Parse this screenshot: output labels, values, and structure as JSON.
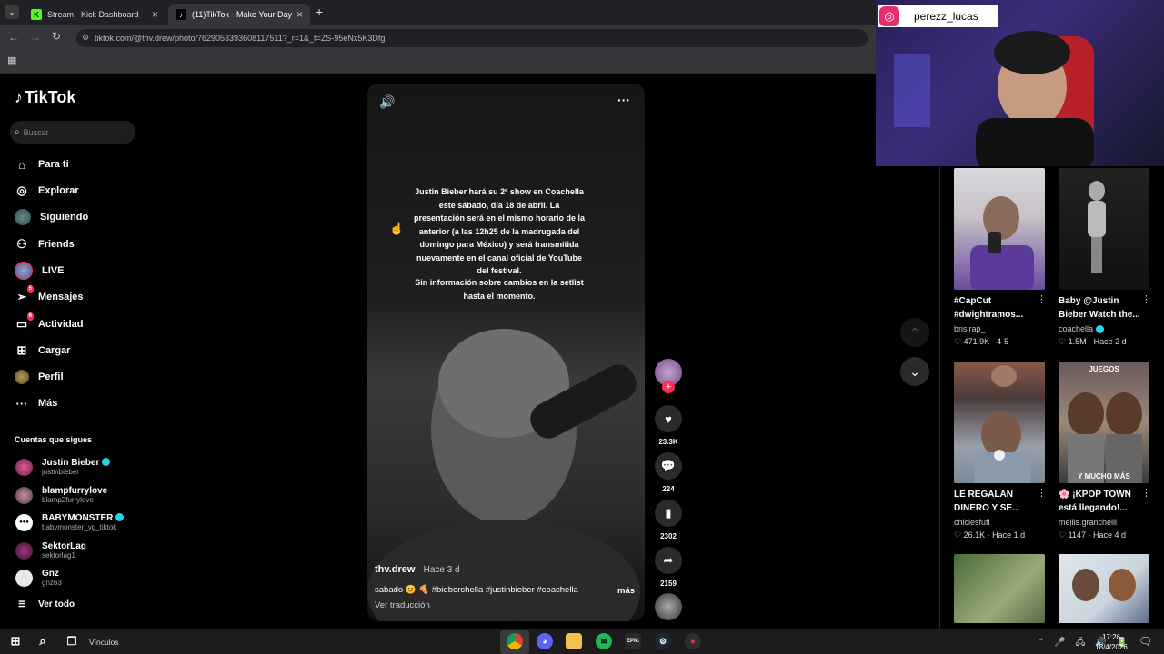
{
  "browser": {
    "tabs": [
      {
        "title": "Stream - Kick Dashboard",
        "active": false
      },
      {
        "title": "(11)TikTok - Make Your Day",
        "active": true
      }
    ],
    "new_tab": "+",
    "url": "tiktok.com/@thv.drew/photo/7629053393608117511?_r=1&_t=ZS-95eNx5K3Dfg"
  },
  "tiktok": {
    "logo": "TikTok",
    "search_placeholder": "Buscar",
    "nav": [
      {
        "label": "Para ti",
        "icon": "home-icon"
      },
      {
        "label": "Explorar",
        "icon": "compass-icon"
      },
      {
        "label": "Siguiendo",
        "icon": "following-avatar"
      },
      {
        "label": "Friends",
        "icon": "friends-icon"
      },
      {
        "label": "LIVE",
        "icon": "live-avatar"
      },
      {
        "label": "Mensajes",
        "icon": "send-icon",
        "badge": "5"
      },
      {
        "label": "Actividad",
        "icon": "activity-icon",
        "badge": "6"
      },
      {
        "label": "Cargar",
        "icon": "plus-icon"
      },
      {
        "label": "Perfil",
        "icon": "profile-avatar"
      },
      {
        "label": "Más",
        "icon": "more-icon"
      }
    ],
    "following_heading": "Cuentas que sigues",
    "following": [
      {
        "name": "Justin Bieber",
        "handle": "justinbieber",
        "verified": true
      },
      {
        "name": "blampfurrylove",
        "handle": "blamp2furrylove",
        "verified": false
      },
      {
        "name": "BABYMONSTER",
        "handle": "babymonster_yg_tiktok",
        "verified": true
      },
      {
        "name": "SektorLag",
        "handle": "sektorlag1",
        "verified": false
      },
      {
        "name": "Gnz",
        "handle": "gnz63",
        "verified": false
      }
    ],
    "see_all": "Ver todo"
  },
  "post": {
    "overlay_text_1": "Justin Bieber hará su 2º show en Coachella este sábado, día 18 de abril. La presentación será en el mismo horario de la anterior (a las 12h25 de la madrugada del domingo para México) y será transmitida nuevamente en el canal oficial de YouTube del festival.",
    "overlay_text_2": "Sin información sobre cambios en la setlist hasta el momento.",
    "author": "thv.drew",
    "time": "· Hace 3 d",
    "caption": "sabado 😊 🍕 #bieberchella #justinbieber #coachella",
    "more": "más",
    "translate": "Ver traducción",
    "likes": "23.3K",
    "comments": "224",
    "saves": "2302",
    "shares": "2159"
  },
  "webcam": {
    "instagram_handle": "perezz_lucas"
  },
  "related": [
    {
      "title": "#CapCut #dwightramos...",
      "author": "bnslrap_",
      "likes": "471.9K",
      "date": "4-5",
      "verified": false,
      "thumb_text": ""
    },
    {
      "title": "Baby @Justin Bieber Watch the...",
      "author": "coachella",
      "likes": "1.5M",
      "date": "Hace 2 d",
      "verified": true,
      "thumb_text": ""
    },
    {
      "title": "LE REGALAN DINERO Y SE...",
      "author": "chiclesfufi",
      "likes": "26.1K",
      "date": "Hace 1 d",
      "verified": false,
      "thumb_text": ""
    },
    {
      "title": "🌸 ¡KPOP TOWN está llegando!...",
      "author": "mellis.granchelli",
      "likes": "1147",
      "date": "Hace 4 d",
      "verified": false,
      "thumb_text": "JUEGOS",
      "thumb_text_2": "Y MUCHO MÁS"
    }
  ],
  "taskbar": {
    "search_label": "Vínculos",
    "time": "17:26",
    "date": "18/4/2026"
  },
  "colors": {
    "accent": "#fe2c55",
    "verified": "#20d5ec",
    "background": "#000000"
  }
}
